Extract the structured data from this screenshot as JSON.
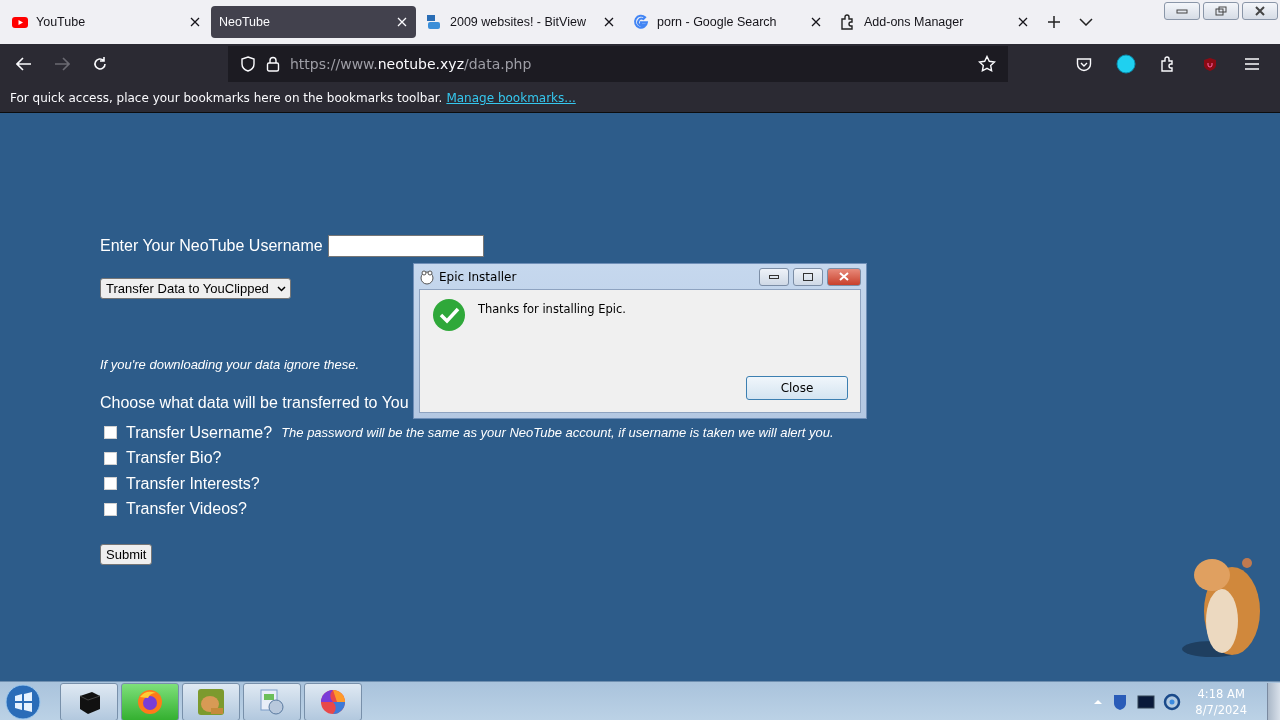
{
  "tabs": [
    {
      "title": "YouTube",
      "kind": "video",
      "selected": false
    },
    {
      "title": "NeoTube",
      "kind": "plain",
      "selected": true
    },
    {
      "title": "2009 websites! - BitView",
      "kind": "tv",
      "selected": false
    },
    {
      "title": "porn - Google Search",
      "kind": "search",
      "selected": false
    },
    {
      "title": "Add-ons Manager",
      "kind": "addons",
      "selected": false
    }
  ],
  "address": {
    "prefix": "https://www.",
    "domain": "neotube.xyz",
    "path": "/data.php"
  },
  "bookmarks_bar": {
    "text": "For quick access, place your bookmarks here on the bookmarks toolbar.",
    "link": "Manage bookmarks..."
  },
  "form": {
    "username_label": "Enter Your NeoTube Username",
    "mode_select": "Transfer Data to YouClipped",
    "hint": "If you're downloading your data ignore these.",
    "choose_label": "Choose what data will be transferred to You",
    "options": [
      {
        "label": "Transfer Username?",
        "note": "The password will be the same as your NeoTube account, if username is taken we will alert you.",
        "checked": false
      },
      {
        "label": "Transfer Bio?",
        "checked": false
      },
      {
        "label": "Transfer Interests?",
        "checked": false
      },
      {
        "label": "Transfer Videos?",
        "checked": false
      }
    ],
    "submit": "Submit"
  },
  "dialog": {
    "title": "Epic Installer",
    "message": "Thanks for installing Epic.",
    "button": "Close"
  },
  "taskbar": {
    "apps": [
      {
        "kind": "box",
        "active": false
      },
      {
        "kind": "firefox",
        "active": true
      },
      {
        "kind": "hamster",
        "active": false
      },
      {
        "kind": "installer",
        "active": false
      },
      {
        "kind": "swirl",
        "active": false
      }
    ],
    "time": "4:18 AM",
    "date": "8/7/2024"
  }
}
